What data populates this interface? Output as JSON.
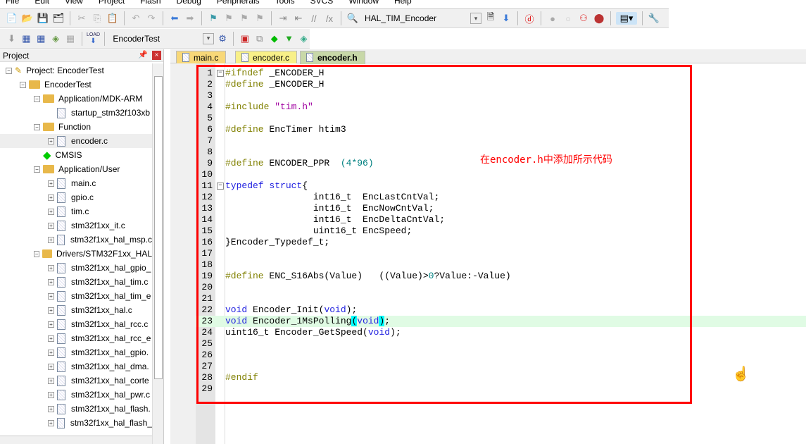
{
  "menu": [
    "File",
    "Edit",
    "View",
    "Project",
    "Flash",
    "Debug",
    "Peripherals",
    "Tools",
    "SVCS",
    "Window",
    "Help"
  ],
  "toolbar1": {
    "target_combo": "HAL_TIM_Encoder"
  },
  "toolbar2": {
    "load_label": "LOAD",
    "project_combo": "EncoderTest"
  },
  "project_panel": {
    "title": "Project",
    "tree": [
      {
        "label": "Project: EncoderTest",
        "level": 0,
        "kind": "project",
        "exp": "-"
      },
      {
        "label": "EncoderTest",
        "level": 1,
        "kind": "target",
        "exp": "-"
      },
      {
        "label": "Application/MDK-ARM",
        "level": 2,
        "kind": "folder",
        "exp": "-"
      },
      {
        "label": "startup_stm32f103xb",
        "level": 3,
        "kind": "file",
        "exp": ""
      },
      {
        "label": "Function",
        "level": 2,
        "kind": "folder",
        "exp": "-"
      },
      {
        "label": "encoder.c",
        "level": 3,
        "kind": "file",
        "exp": "+",
        "selected": true
      },
      {
        "label": "CMSIS",
        "level": 2,
        "kind": "cmsis",
        "exp": ""
      },
      {
        "label": "Application/User",
        "level": 2,
        "kind": "folder",
        "exp": "-"
      },
      {
        "label": "main.c",
        "level": 3,
        "kind": "file",
        "exp": "+"
      },
      {
        "label": "gpio.c",
        "level": 3,
        "kind": "file",
        "exp": "+"
      },
      {
        "label": "tim.c",
        "level": 3,
        "kind": "file",
        "exp": "+"
      },
      {
        "label": "stm32f1xx_it.c",
        "level": 3,
        "kind": "file",
        "exp": "+"
      },
      {
        "label": "stm32f1xx_hal_msp.c",
        "level": 3,
        "kind": "file",
        "exp": "+"
      },
      {
        "label": "Drivers/STM32F1xx_HAL",
        "level": 2,
        "kind": "folder",
        "exp": "-"
      },
      {
        "label": "stm32f1xx_hal_gpio_",
        "level": 3,
        "kind": "file",
        "exp": "+"
      },
      {
        "label": "stm32f1xx_hal_tim.c",
        "level": 3,
        "kind": "file",
        "exp": "+"
      },
      {
        "label": "stm32f1xx_hal_tim_e",
        "level": 3,
        "kind": "file",
        "exp": "+"
      },
      {
        "label": "stm32f1xx_hal.c",
        "level": 3,
        "kind": "file",
        "exp": "+"
      },
      {
        "label": "stm32f1xx_hal_rcc.c",
        "level": 3,
        "kind": "file",
        "exp": "+"
      },
      {
        "label": "stm32f1xx_hal_rcc_e",
        "level": 3,
        "kind": "file",
        "exp": "+"
      },
      {
        "label": "stm32f1xx_hal_gpio.",
        "level": 3,
        "kind": "file",
        "exp": "+"
      },
      {
        "label": "stm32f1xx_hal_dma.",
        "level": 3,
        "kind": "file",
        "exp": "+"
      },
      {
        "label": "stm32f1xx_hal_corte",
        "level": 3,
        "kind": "file",
        "exp": "+"
      },
      {
        "label": "stm32f1xx_hal_pwr.c",
        "level": 3,
        "kind": "file",
        "exp": "+"
      },
      {
        "label": "stm32f1xx_hal_flash.",
        "level": 3,
        "kind": "file",
        "exp": "+"
      },
      {
        "label": "stm32f1xx_hal_flash_",
        "level": 3,
        "kind": "file",
        "exp": "+"
      }
    ]
  },
  "tabs": [
    {
      "label": "main.c",
      "color": "#f8d878"
    },
    {
      "label": "encoder.c",
      "color": "#f8f088"
    },
    {
      "label": "encoder.h",
      "color": "#c8d8a8",
      "active": true
    }
  ],
  "code": [
    {
      "n": "1",
      "fold": "-",
      "t": [
        [
          "pp",
          "#ifndef"
        ],
        [
          "tx",
          " _ENCODER_H"
        ]
      ]
    },
    {
      "n": "2",
      "t": [
        [
          "pp",
          "#define"
        ],
        [
          "tx",
          " _ENCODER_H"
        ]
      ]
    },
    {
      "n": "3",
      "t": []
    },
    {
      "n": "4",
      "t": [
        [
          "pp",
          "#include"
        ],
        [
          "tx",
          " "
        ],
        [
          "st",
          "\"tim.h\""
        ]
      ]
    },
    {
      "n": "5",
      "t": []
    },
    {
      "n": "6",
      "t": [
        [
          "pp",
          "#define"
        ],
        [
          "tx",
          " EncTimer htim3"
        ]
      ]
    },
    {
      "n": "7",
      "t": []
    },
    {
      "n": "8",
      "t": []
    },
    {
      "n": "9",
      "t": [
        [
          "pp",
          "#define"
        ],
        [
          "tx",
          " ENCODER_PPR  "
        ],
        [
          "nm",
          "(4*96)"
        ]
      ]
    },
    {
      "n": "10",
      "t": []
    },
    {
      "n": "11",
      "fold": "-",
      "t": [
        [
          "kw",
          "typedef"
        ],
        [
          "tx",
          " "
        ],
        [
          "kw",
          "struct"
        ],
        [
          "tx",
          "{"
        ]
      ]
    },
    {
      "n": "12",
      "t": [
        [
          "tx",
          "                int16_t  EncLastCntVal;"
        ]
      ]
    },
    {
      "n": "13",
      "t": [
        [
          "tx",
          "                int16_t  EncNowCntVal;"
        ]
      ]
    },
    {
      "n": "14",
      "t": [
        [
          "tx",
          "                int16_t  EncDeltaCntVal;"
        ]
      ]
    },
    {
      "n": "15",
      "t": [
        [
          "tx",
          "                uint16_t EncSpeed;"
        ]
      ]
    },
    {
      "n": "16",
      "t": [
        [
          "tx",
          "}Encoder_Typedef_t;"
        ]
      ]
    },
    {
      "n": "17",
      "t": []
    },
    {
      "n": "18",
      "t": []
    },
    {
      "n": "19",
      "t": [
        [
          "pp",
          "#define"
        ],
        [
          "tx",
          " ENC_S16Abs(Value)   ((Value)>"
        ],
        [
          "nm",
          "0"
        ],
        [
          "tx",
          "?Value:-Value)"
        ]
      ]
    },
    {
      "n": "20",
      "t": []
    },
    {
      "n": "21",
      "t": []
    },
    {
      "n": "22",
      "t": [
        [
          "kw",
          "void"
        ],
        [
          "tx",
          " Encoder_Init("
        ],
        [
          "kw",
          "void"
        ],
        [
          "tx",
          ");"
        ]
      ]
    },
    {
      "n": "23",
      "hl": true,
      "t": [
        [
          "kw",
          "void"
        ],
        [
          "tx",
          " Encoder_1MsPolling"
        ],
        [
          "br",
          "("
        ],
        [
          "kw",
          "void"
        ],
        [
          "br",
          ")"
        ],
        [
          "tx",
          ";"
        ]
      ]
    },
    {
      "n": "24",
      "t": [
        [
          "tx",
          "uint16_t Encoder_GetSpeed("
        ],
        [
          "kw",
          "void"
        ],
        [
          "tx",
          ");"
        ]
      ]
    },
    {
      "n": "25",
      "t": []
    },
    {
      "n": "26",
      "t": []
    },
    {
      "n": "27",
      "t": []
    },
    {
      "n": "28",
      "t": [
        [
          "pp",
          "#endif"
        ]
      ]
    },
    {
      "n": "29",
      "t": []
    }
  ],
  "annotation": "在encoder.h中添加所示代码",
  "colors": {
    "highlight_box": "#ff0000",
    "current_line": "#e0fbe4",
    "preprocessor": "#808000",
    "keyword": "#2020e0"
  }
}
